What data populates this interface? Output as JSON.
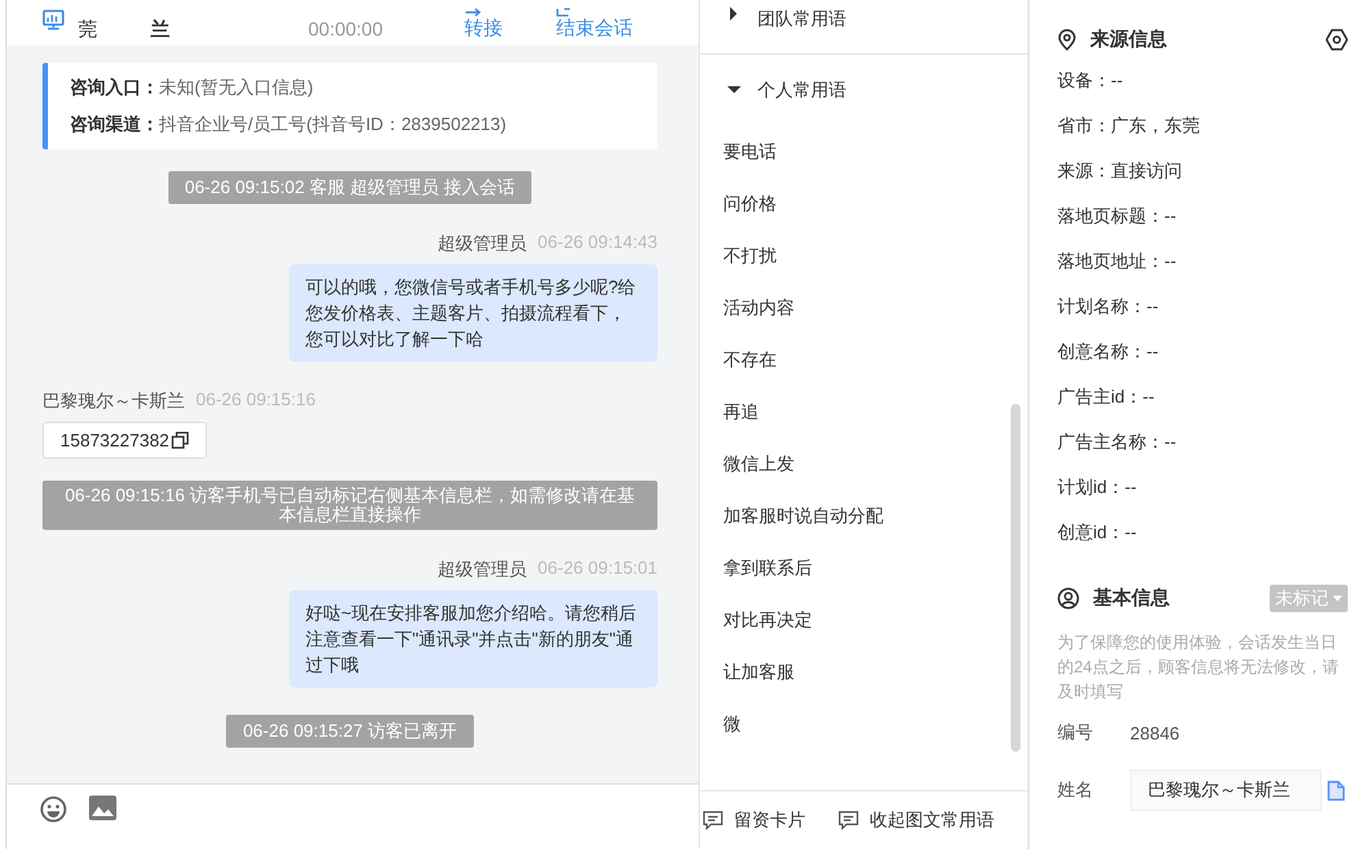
{
  "chat_header": {
    "location": "莞",
    "visitor_name": "兰",
    "session_time": "00:00:00",
    "actions": [
      {
        "label": "转接",
        "kind": "transfer"
      },
      {
        "label": "结束会话",
        "kind": "end"
      }
    ]
  },
  "inquiry_info": [
    {
      "label": "咨询入口：",
      "value": "未知(暂无入口信息)"
    },
    {
      "label": "咨询渠道：",
      "value": "抖音企业号/员工号(抖音号ID：2839502213)"
    }
  ],
  "messages": [
    {
      "kind": "system",
      "text": "06-26 09:15:02 客服 超级管理员 接入会话"
    },
    {
      "kind": "agent",
      "sender": "超级管理员",
      "time": "06-26 09:14:43",
      "text": "可以的哦，您微信号或者手机号多少呢?给您发价格表、主题客片、拍摄流程看下，您可以对比了解一下哈"
    },
    {
      "kind": "visitor",
      "sender": "巴黎瑰尔～卡斯兰",
      "time": "06-26 09:15:16",
      "text": "15873227382"
    },
    {
      "kind": "system",
      "text": "06-26 09:15:16 访客手机号已自动标记右侧基本信息栏，如需修改请在基本信息栏直接操作"
    },
    {
      "kind": "agent",
      "sender": "超级管理员",
      "time": "06-26 09:15:01",
      "text": "好哒~现在安排客服加您介绍哈。请您稍后注意查看一下\"通讯录\"并点击\"新的朋友\"通过下哦"
    },
    {
      "kind": "system",
      "text": "06-26 09:15:27 访客已离开"
    }
  ],
  "phrase_groups": [
    {
      "label": "团队常用语",
      "expanded": false
    },
    {
      "label": "个人常用语",
      "expanded": true,
      "items": [
        "要电话",
        "问价格",
        "不打扰",
        "活动内容",
        "不存在",
        "再追",
        "微信上发",
        "加客服时说自动分配",
        "拿到联系后",
        "对比再决定",
        "让加客服",
        "微"
      ]
    }
  ],
  "phrase_footer": [
    {
      "label": "留资卡片"
    },
    {
      "label": "收起图文常用语"
    }
  ],
  "source_info": {
    "title": "来源信息",
    "rows": [
      "设备：--",
      "省市：广东，东莞",
      "来源：直接访问",
      "落地页标题：--",
      "落地页地址：--",
      "计划名称：--",
      "创意名称：--",
      "广告主id：--",
      "广告主名称：--",
      "计划id：--",
      "创意id：--"
    ]
  },
  "basic_info": {
    "title": "基本信息",
    "tag": "未标记",
    "note": "为了保障您的使用体验，会话发生当日的24点之后，顾客信息将无法修改，请及时填写",
    "fields": [
      {
        "kind": "text",
        "label": "编号",
        "value": "28846"
      },
      {
        "kind": "input",
        "label": "姓名",
        "value": "巴黎瑰尔～卡斯兰"
      }
    ]
  }
}
